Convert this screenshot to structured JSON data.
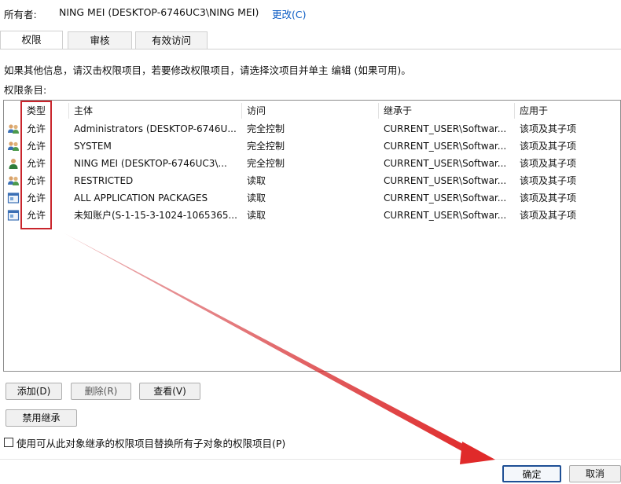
{
  "owner": {
    "label": "所有者:",
    "value": "NING MEI (DESKTOP-6746UC3\\NING MEI)",
    "change_link": "更改(C)"
  },
  "tabs": [
    {
      "label": "权限",
      "active": true
    },
    {
      "label": "审核",
      "active": false
    },
    {
      "label": "有效访问",
      "active": false
    }
  ],
  "info_text": "如果其他信息，请汉击权限项目，若要修改权限项目，请选择汶项目并单主 编辑 (如果可用)。",
  "entries_label": "权限条目:",
  "columns": [
    "类型",
    "主体",
    "访问",
    "继承于",
    "应用于"
  ],
  "rows": [
    {
      "icon": "users-group-icon",
      "type": "允许",
      "principal": "Administrators (DESKTOP-6746U...",
      "access": "完全控制",
      "inherited": "CURRENT_USER\\Softwar...",
      "applies": "该项及其子项"
    },
    {
      "icon": "users-group-icon",
      "type": "允许",
      "principal": "SYSTEM",
      "access": "完全控制",
      "inherited": "CURRENT_USER\\Softwar...",
      "applies": "该项及其子项"
    },
    {
      "icon": "single-user-icon",
      "type": "允许",
      "principal": "NING MEI (DESKTOP-6746UC3\\...",
      "access": "完全控制",
      "inherited": "CURRENT_USER\\Softwar...",
      "applies": "该项及其子项"
    },
    {
      "icon": "users-group-icon",
      "type": "允许",
      "principal": "RESTRICTED",
      "access": "读取",
      "inherited": "CURRENT_USER\\Softwar...",
      "applies": "该项及其子项"
    },
    {
      "icon": "app-package-icon",
      "type": "允许",
      "principal": "ALL APPLICATION PACKAGES",
      "access": "读取",
      "inherited": "CURRENT_USER\\Softwar...",
      "applies": "该项及其子项"
    },
    {
      "icon": "app-package-icon",
      "type": "允许",
      "principal": "未知账户(S-1-15-3-1024-1065365...",
      "access": "读取",
      "inherited": "CURRENT_USER\\Softwar...",
      "applies": "该项及其子项"
    }
  ],
  "buttons": {
    "add": "添加(D)",
    "remove": "删除(R)",
    "view": "查看(V)",
    "disable_inheritance": "禁用继承",
    "ok": "确定",
    "cancel": "取消"
  },
  "replace_checkbox": {
    "label": "使用可从此对象继承的权限项目替换所有子对象的权限项目(P)",
    "checked": false
  },
  "annotation_color": "#c9252c"
}
